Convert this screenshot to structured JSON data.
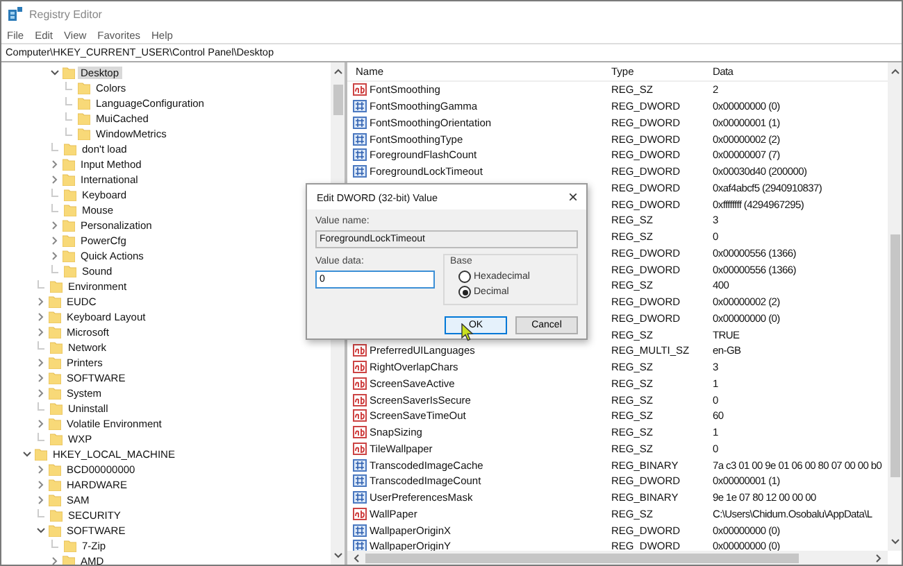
{
  "window": {
    "title": "Registry Editor"
  },
  "menu": [
    "File",
    "Edit",
    "View",
    "Favorites",
    "Help"
  ],
  "address": "Computer\\HKEY_CURRENT_USER\\Control Panel\\Desktop",
  "tree": [
    {
      "kind": "hidden",
      "children": [
        {
          "kind": "hidden",
          "children": [
            {
              "label": "Desktop",
              "kind": "branch",
              "expanded": true,
              "selected": true,
              "children": [
                {
                  "label": "Colors",
                  "kind": "leaf",
                  "selected": false
                },
                {
                  "label": "LanguageConfiguration",
                  "kind": "leaf",
                  "selected": false
                },
                {
                  "label": "MuiCached",
                  "kind": "leaf",
                  "selected": false
                },
                {
                  "label": "WindowMetrics",
                  "kind": "leaf",
                  "selected": false
                }
              ]
            },
            {
              "label": "don't load",
              "kind": "leaf",
              "selected": false
            },
            {
              "label": "Input Method",
              "kind": "branch",
              "expanded": false,
              "selected": false
            },
            {
              "label": "International",
              "kind": "branch",
              "expanded": false,
              "selected": false
            },
            {
              "label": "Keyboard",
              "kind": "leaf",
              "selected": false
            },
            {
              "label": "Mouse",
              "kind": "leaf",
              "selected": false
            },
            {
              "label": "Personalization",
              "kind": "branch",
              "expanded": false,
              "selected": false
            },
            {
              "label": "PowerCfg",
              "kind": "branch",
              "expanded": false,
              "selected": false
            },
            {
              "label": "Quick Actions",
              "kind": "branch",
              "expanded": false,
              "selected": false
            },
            {
              "label": "Sound",
              "kind": "leaf",
              "selected": false
            }
          ]
        },
        {
          "label": "Environment",
          "kind": "leaf",
          "selected": false
        },
        {
          "label": "EUDC",
          "kind": "branch",
          "expanded": false,
          "selected": false
        },
        {
          "label": "Keyboard Layout",
          "kind": "branch",
          "expanded": false,
          "selected": false
        },
        {
          "label": "Microsoft",
          "kind": "branch",
          "expanded": false,
          "selected": false
        },
        {
          "label": "Network",
          "kind": "leaf",
          "selected": false
        },
        {
          "label": "Printers",
          "kind": "branch",
          "expanded": false,
          "selected": false
        },
        {
          "label": "SOFTWARE",
          "kind": "branch",
          "expanded": false,
          "selected": false
        },
        {
          "label": "System",
          "kind": "branch",
          "expanded": false,
          "selected": false
        },
        {
          "label": "Uninstall",
          "kind": "leaf",
          "selected": false
        },
        {
          "label": "Volatile Environment",
          "kind": "branch",
          "expanded": false,
          "selected": false
        },
        {
          "label": "WXP",
          "kind": "leaf",
          "selected": false
        }
      ]
    },
    {
      "label": "HKEY_LOCAL_MACHINE",
      "kind": "branch",
      "expanded": true,
      "selected": false,
      "children": [
        {
          "label": "BCD00000000",
          "kind": "branch",
          "expanded": false,
          "selected": false
        },
        {
          "label": "HARDWARE",
          "kind": "branch",
          "expanded": false,
          "selected": false
        },
        {
          "label": "SAM",
          "kind": "branch",
          "expanded": false,
          "selected": false
        },
        {
          "label": "SECURITY",
          "kind": "leaf",
          "selected": false
        },
        {
          "label": "SOFTWARE",
          "kind": "branch",
          "expanded": true,
          "selected": false,
          "children": [
            {
              "label": "7-Zip",
              "kind": "leaf",
              "selected": false
            },
            {
              "label": "AMD",
              "kind": "branch",
              "expanded": false,
              "selected": false
            }
          ]
        }
      ]
    }
  ],
  "table": {
    "columns": [
      "Name",
      "Type",
      "Data"
    ],
    "rows": [
      {
        "kind": "string",
        "name": "FontSmoothing",
        "type": "REG_SZ",
        "data": "2"
      },
      {
        "kind": "binary",
        "name": "FontSmoothingGamma",
        "type": "REG_DWORD",
        "data": "0x00000000 (0)"
      },
      {
        "kind": "binary",
        "name": "FontSmoothingOrientation",
        "type": "REG_DWORD",
        "data": "0x00000001 (1)"
      },
      {
        "kind": "binary",
        "name": "FontSmoothingType",
        "type": "REG_DWORD",
        "data": "0x00000002 (2)"
      },
      {
        "kind": "binary",
        "name": "ForegroundFlashCount",
        "type": "REG_DWORD",
        "data": "0x00000007 (7)"
      },
      {
        "kind": "binary",
        "name": "ForegroundLockTimeout",
        "type": "REG_DWORD",
        "data": "0x00030d40 (200000)"
      },
      {
        "type": "REG_DWORD",
        "data": "0xaf4abcf5 (2940910837)"
      },
      {
        "type": "REG_DWORD",
        "data": "0xffffffff (4294967295)"
      },
      {
        "type": "REG_SZ",
        "data": "3"
      },
      {
        "type": "REG_SZ",
        "data": "0"
      },
      {
        "type": "REG_DWORD",
        "data": "0x00000556 (1366)"
      },
      {
        "type": "REG_DWORD",
        "data": "0x00000556 (1366)"
      },
      {
        "type": "REG_SZ",
        "data": "400"
      },
      {
        "type": "REG_DWORD",
        "data": "0x00000002 (2)"
      },
      {
        "type": "REG_DWORD",
        "data": "0x00000000 (0)"
      },
      {
        "type": "REG_SZ",
        "data": "TRUE"
      },
      {
        "kind": "string",
        "name": "PreferredUILanguages",
        "type": "REG_MULTI_SZ",
        "data": "en-GB"
      },
      {
        "kind": "string",
        "name": "RightOverlapChars",
        "type": "REG_SZ",
        "data": "3"
      },
      {
        "kind": "string",
        "name": "ScreenSaveActive",
        "type": "REG_SZ",
        "data": "1"
      },
      {
        "kind": "string",
        "name": "ScreenSaverIsSecure",
        "type": "REG_SZ",
        "data": "0"
      },
      {
        "kind": "string",
        "name": "ScreenSaveTimeOut",
        "type": "REG_SZ",
        "data": "60"
      },
      {
        "kind": "string",
        "name": "SnapSizing",
        "type": "REG_SZ",
        "data": "1"
      },
      {
        "kind": "string",
        "name": "TileWallpaper",
        "type": "REG_SZ",
        "data": "0"
      },
      {
        "kind": "binary",
        "name": "TranscodedImageCache",
        "type": "REG_BINARY",
        "data": "7a c3 01 00 9e 01 06 00 80 07 00 00 b0"
      },
      {
        "kind": "binary",
        "name": "TranscodedImageCount",
        "type": "REG_DWORD",
        "data": "0x00000001 (1)"
      },
      {
        "kind": "binary",
        "name": "UserPreferencesMask",
        "type": "REG_BINARY",
        "data": "9e 1e 07 80 12 00 00 00"
      },
      {
        "kind": "string",
        "name": "WallPaper",
        "type": "REG_SZ",
        "data": "C:\\Users\\Chidum.Osobalu\\AppData\\L"
      },
      {
        "kind": "binary",
        "name": "WallpaperOriginX",
        "type": "REG_DWORD",
        "data": "0x00000000 (0)"
      },
      {
        "kind": "binary",
        "name": "WallpaperOriginY",
        "type": "REG_DWORD",
        "data": "0x00000000 (0)"
      }
    ]
  },
  "dialog": {
    "title": "Edit DWORD (32-bit) Value",
    "close": "×",
    "value_name_label": "Value name:",
    "value_name": "ForegroundLockTimeout",
    "value_data_label": "Value data:",
    "value_data": "0",
    "base_label": "Base",
    "base_options": [
      {
        "label": "Hexadecimal",
        "selected": false
      },
      {
        "label": "Decimal",
        "selected": true
      }
    ],
    "buttons": [
      {
        "label": "OK",
        "focused": true
      },
      {
        "label": "Cancel",
        "focused": false
      }
    ]
  }
}
